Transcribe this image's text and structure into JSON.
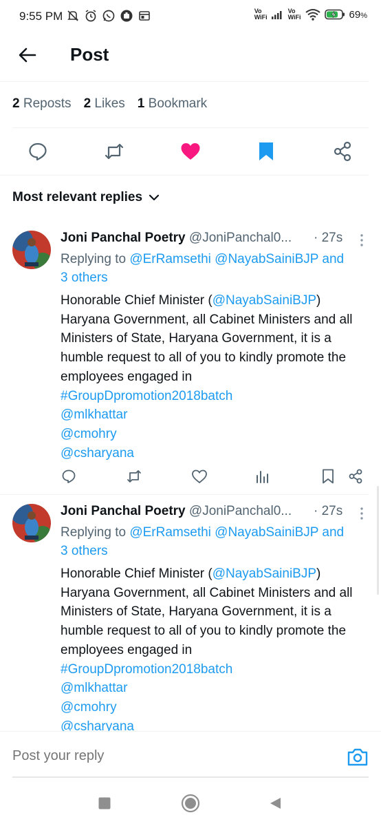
{
  "status_bar": {
    "time": "9:55 PM",
    "vowifi_1_top": "Vo",
    "vowifi_1_bottom": "WiFi",
    "vowifi_2_top": "Vo",
    "vowifi_2_bottom": "WiFi",
    "battery": "69",
    "battery_unit": "%",
    "left_icons": [
      "mute-icon",
      "alarm-icon",
      "whatsapp-icon",
      "app-icon",
      "news-icon"
    ]
  },
  "header": {
    "title": "Post"
  },
  "stats": {
    "reposts_count": "2",
    "reposts_label": "Reposts",
    "likes_count": "2",
    "likes_label": "Likes",
    "bookmarks_count": "1",
    "bookmarks_label": "Bookmark"
  },
  "actions": [
    "reply-icon",
    "repost-icon",
    "like-icon",
    "bookmark-icon",
    "share-icon"
  ],
  "colors": {
    "like": "#f91880",
    "bookmark": "#1d9bf0",
    "link": "#1d9bf0",
    "muted": "#536471",
    "text": "#0f1419"
  },
  "sort": {
    "label": "Most relevant replies"
  },
  "replies": [
    {
      "name": "Joni Panchal Poetry",
      "handle": "@JoniPanchal0...",
      "time": "· 27s",
      "replying_prefix": "Replying to ",
      "replying_to_1": "@ErRamsethi",
      "replying_to_2": "@NayabSainiBJP",
      "replying_and": "and",
      "replying_others": "3 others",
      "body_1": "Honorable Chief Minister (",
      "body_mention": "@NayabSainiBJP",
      "body_2": ") Haryana Government, all Cabinet Ministers and all Ministers of State, Haryana Government, it is a humble request to all of you to kindly promote the employees engaged in",
      "hashtag": "#GroupDpromotion2018batch",
      "mention_1": "@mlkhattar",
      "mention_2": "@cmohry",
      "mention_3": "@csharyana"
    },
    {
      "name": "Joni Panchal Poetry",
      "handle": "@JoniPanchal0...",
      "time": "· 27s",
      "replying_prefix": "Replying to ",
      "replying_to_1": "@ErRamsethi",
      "replying_to_2": "@NayabSainiBJP",
      "replying_and": "and",
      "replying_others": "3 others",
      "body_1": "Honorable Chief Minister (",
      "body_mention": "@NayabSainiBJP",
      "body_2": ") Haryana Government, all Cabinet Ministers and all Ministers of State, Haryana Government, it is a humble request to all of you to kindly promote the employees engaged in",
      "hashtag": "#GroupDpromotion2018batch",
      "mention_1": "@mlkhattar",
      "mention_2": "@cmohry",
      "mention_3": "@csharyana"
    }
  ],
  "composer": {
    "placeholder": "Post your reply"
  },
  "nav": [
    "recents-icon",
    "home-icon",
    "back-nav-icon"
  ]
}
